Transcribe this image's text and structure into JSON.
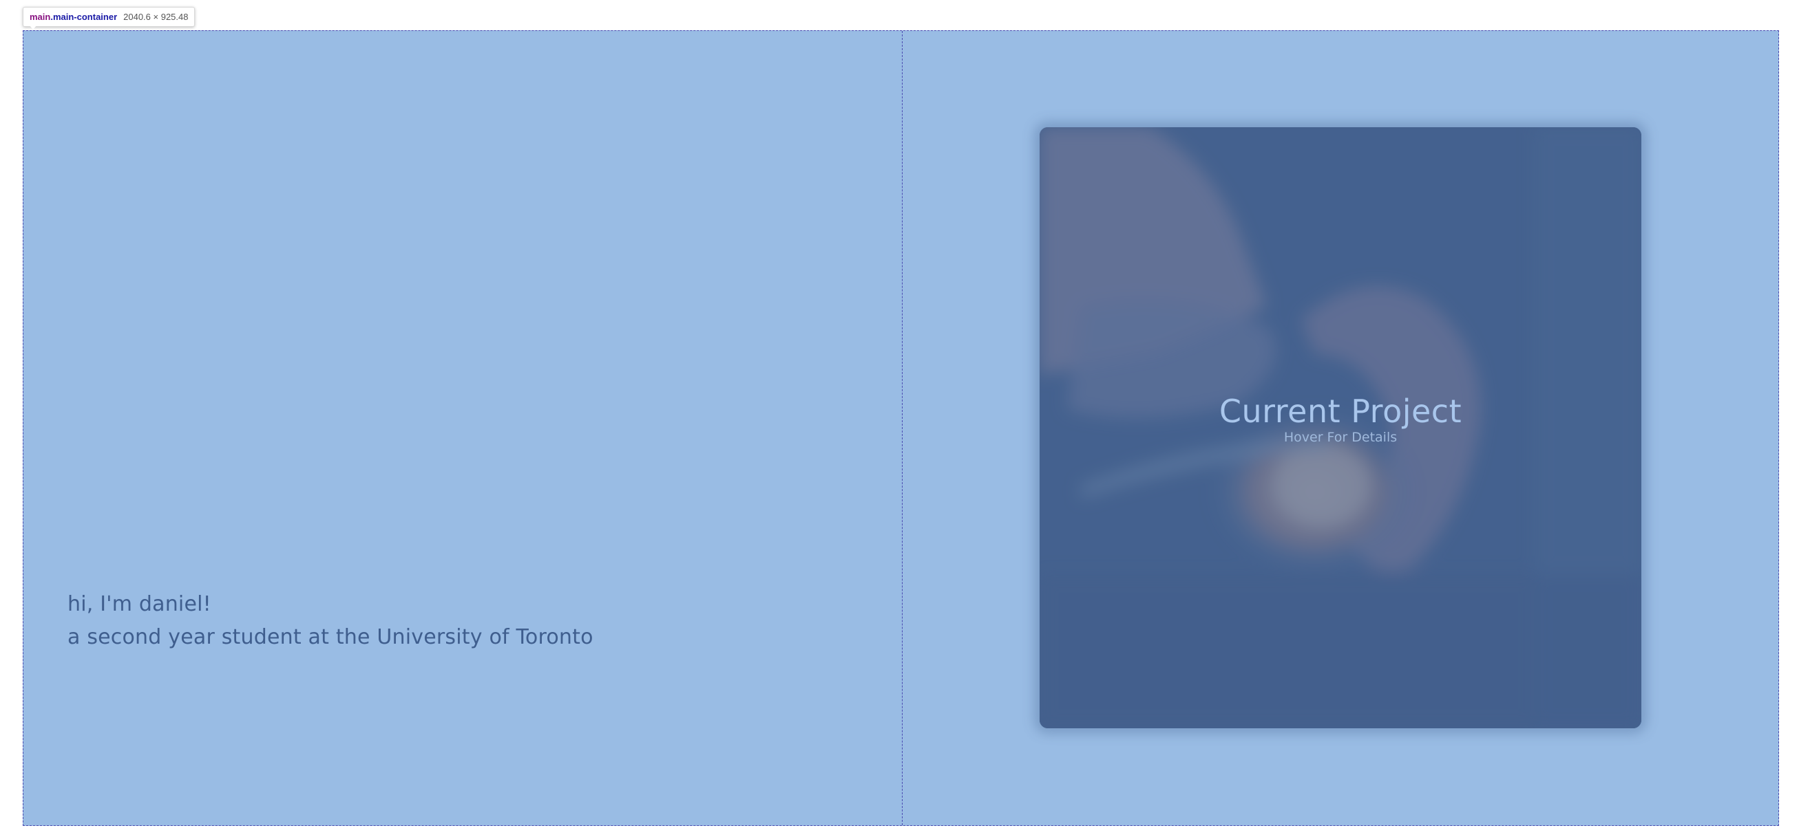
{
  "devtools": {
    "tag": "main",
    "class_name": ".main-container",
    "dimensions": "2040.6 × 925.48"
  },
  "intro": {
    "greeting": "hi, I'm daniel!",
    "tagline": "a second year student at the University of Toronto"
  },
  "project": {
    "title": "Current Project",
    "subtitle": "Hover For Details",
    "image_subject": "latte-art-photo"
  },
  "colors": {
    "page_background": "#99bce4",
    "intro_text": "#3f5e8e",
    "card_overlay": "#486998",
    "card_title": "#a9c6ec"
  }
}
